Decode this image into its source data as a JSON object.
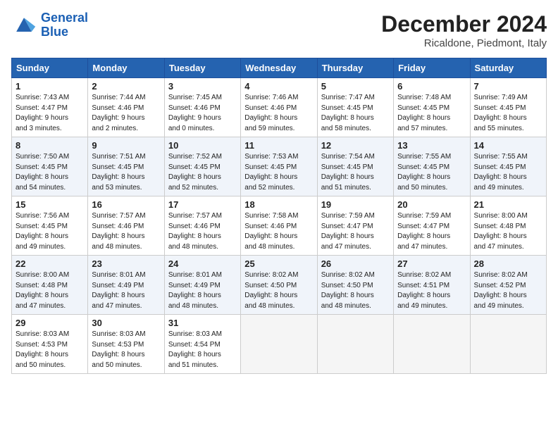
{
  "header": {
    "logo_line1": "General",
    "logo_line2": "Blue",
    "title": "December 2024",
    "subtitle": "Ricaldone, Piedmont, Italy"
  },
  "columns": [
    "Sunday",
    "Monday",
    "Tuesday",
    "Wednesday",
    "Thursday",
    "Friday",
    "Saturday"
  ],
  "weeks": [
    [
      {
        "day": "1",
        "detail": "Sunrise: 7:43 AM\nSunset: 4:47 PM\nDaylight: 9 hours\nand 3 minutes."
      },
      {
        "day": "2",
        "detail": "Sunrise: 7:44 AM\nSunset: 4:46 PM\nDaylight: 9 hours\nand 2 minutes."
      },
      {
        "day": "3",
        "detail": "Sunrise: 7:45 AM\nSunset: 4:46 PM\nDaylight: 9 hours\nand 0 minutes."
      },
      {
        "day": "4",
        "detail": "Sunrise: 7:46 AM\nSunset: 4:46 PM\nDaylight: 8 hours\nand 59 minutes."
      },
      {
        "day": "5",
        "detail": "Sunrise: 7:47 AM\nSunset: 4:45 PM\nDaylight: 8 hours\nand 58 minutes."
      },
      {
        "day": "6",
        "detail": "Sunrise: 7:48 AM\nSunset: 4:45 PM\nDaylight: 8 hours\nand 57 minutes."
      },
      {
        "day": "7",
        "detail": "Sunrise: 7:49 AM\nSunset: 4:45 PM\nDaylight: 8 hours\nand 55 minutes."
      }
    ],
    [
      {
        "day": "8",
        "detail": "Sunrise: 7:50 AM\nSunset: 4:45 PM\nDaylight: 8 hours\nand 54 minutes."
      },
      {
        "day": "9",
        "detail": "Sunrise: 7:51 AM\nSunset: 4:45 PM\nDaylight: 8 hours\nand 53 minutes."
      },
      {
        "day": "10",
        "detail": "Sunrise: 7:52 AM\nSunset: 4:45 PM\nDaylight: 8 hours\nand 52 minutes."
      },
      {
        "day": "11",
        "detail": "Sunrise: 7:53 AM\nSunset: 4:45 PM\nDaylight: 8 hours\nand 52 minutes."
      },
      {
        "day": "12",
        "detail": "Sunrise: 7:54 AM\nSunset: 4:45 PM\nDaylight: 8 hours\nand 51 minutes."
      },
      {
        "day": "13",
        "detail": "Sunrise: 7:55 AM\nSunset: 4:45 PM\nDaylight: 8 hours\nand 50 minutes."
      },
      {
        "day": "14",
        "detail": "Sunrise: 7:55 AM\nSunset: 4:45 PM\nDaylight: 8 hours\nand 49 minutes."
      }
    ],
    [
      {
        "day": "15",
        "detail": "Sunrise: 7:56 AM\nSunset: 4:45 PM\nDaylight: 8 hours\nand 49 minutes."
      },
      {
        "day": "16",
        "detail": "Sunrise: 7:57 AM\nSunset: 4:46 PM\nDaylight: 8 hours\nand 48 minutes."
      },
      {
        "day": "17",
        "detail": "Sunrise: 7:57 AM\nSunset: 4:46 PM\nDaylight: 8 hours\nand 48 minutes."
      },
      {
        "day": "18",
        "detail": "Sunrise: 7:58 AM\nSunset: 4:46 PM\nDaylight: 8 hours\nand 48 minutes."
      },
      {
        "day": "19",
        "detail": "Sunrise: 7:59 AM\nSunset: 4:47 PM\nDaylight: 8 hours\nand 47 minutes."
      },
      {
        "day": "20",
        "detail": "Sunrise: 7:59 AM\nSunset: 4:47 PM\nDaylight: 8 hours\nand 47 minutes."
      },
      {
        "day": "21",
        "detail": "Sunrise: 8:00 AM\nSunset: 4:48 PM\nDaylight: 8 hours\nand 47 minutes."
      }
    ],
    [
      {
        "day": "22",
        "detail": "Sunrise: 8:00 AM\nSunset: 4:48 PM\nDaylight: 8 hours\nand 47 minutes."
      },
      {
        "day": "23",
        "detail": "Sunrise: 8:01 AM\nSunset: 4:49 PM\nDaylight: 8 hours\nand 47 minutes."
      },
      {
        "day": "24",
        "detail": "Sunrise: 8:01 AM\nSunset: 4:49 PM\nDaylight: 8 hours\nand 48 minutes."
      },
      {
        "day": "25",
        "detail": "Sunrise: 8:02 AM\nSunset: 4:50 PM\nDaylight: 8 hours\nand 48 minutes."
      },
      {
        "day": "26",
        "detail": "Sunrise: 8:02 AM\nSunset: 4:50 PM\nDaylight: 8 hours\nand 48 minutes."
      },
      {
        "day": "27",
        "detail": "Sunrise: 8:02 AM\nSunset: 4:51 PM\nDaylight: 8 hours\nand 49 minutes."
      },
      {
        "day": "28",
        "detail": "Sunrise: 8:02 AM\nSunset: 4:52 PM\nDaylight: 8 hours\nand 49 minutes."
      }
    ],
    [
      {
        "day": "29",
        "detail": "Sunrise: 8:03 AM\nSunset: 4:53 PM\nDaylight: 8 hours\nand 50 minutes."
      },
      {
        "day": "30",
        "detail": "Sunrise: 8:03 AM\nSunset: 4:53 PM\nDaylight: 8 hours\nand 50 minutes."
      },
      {
        "day": "31",
        "detail": "Sunrise: 8:03 AM\nSunset: 4:54 PM\nDaylight: 8 hours\nand 51 minutes."
      },
      null,
      null,
      null,
      null
    ]
  ]
}
